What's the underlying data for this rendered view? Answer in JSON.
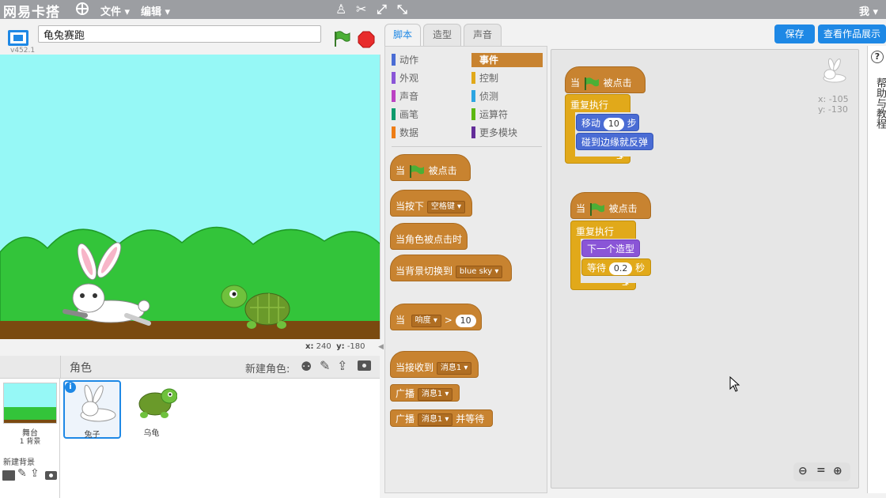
{
  "topbar": {
    "logo": "网易卡搭",
    "menu_file": "文件",
    "menu_edit": "编辑",
    "user": "我"
  },
  "stage": {
    "project_title": "龟兔赛跑",
    "version": "v452.1",
    "mouse_x_label": "x:",
    "mouse_x": "240",
    "mouse_y_label": "y:",
    "mouse_y": "-180"
  },
  "sprites": {
    "header_label": "角色",
    "new_sprite_label": "新建角色:",
    "stage_name": "舞台",
    "stage_backdrops": "1 背景",
    "new_backdrop_label": "新建背景",
    "list": [
      {
        "name": "兔子"
      },
      {
        "name": "乌龟"
      }
    ]
  },
  "tabs": {
    "scripts": "脚本",
    "costumes": "造型",
    "sounds": "声音"
  },
  "buttons": {
    "save": "保存",
    "see_project": "查看作品展示"
  },
  "categories": [
    {
      "label": "动作",
      "color": "#4a6cd4"
    },
    {
      "label": "事件",
      "color": "#c88330"
    },
    {
      "label": "外观",
      "color": "#8a55d7"
    },
    {
      "label": "控制",
      "color": "#e1a91a"
    },
    {
      "label": "声音",
      "color": "#bb42c3"
    },
    {
      "label": "侦测",
      "color": "#2ca5e2"
    },
    {
      "label": "画笔",
      "color": "#0e9a6c"
    },
    {
      "label": "运算符",
      "color": "#5cb712"
    },
    {
      "label": "数据",
      "color": "#ee7d16"
    },
    {
      "label": "更多模块",
      "color": "#632d99"
    }
  ],
  "palette": {
    "when": "当",
    "clicked": "被点击",
    "when_key": "当按下",
    "key_space": "空格键",
    "when_sprite_clicked": "当角色被点击时",
    "when_backdrop": "当背景切换到",
    "backdrop_name": "blue sky",
    "when2": "当",
    "loudness": "响度",
    "gt": ">",
    "loud_value": "10",
    "when_receive": "当接收到",
    "msg1": "消息1",
    "broadcast": "广播",
    "msg2": "消息1",
    "broadcast2": "广播",
    "msg3": "消息1",
    "and_wait": "并等待"
  },
  "script1": {
    "when": "当",
    "clicked": "被点击",
    "forever": "重复执行",
    "move": "移动",
    "steps_value": "10",
    "steps": "步",
    "bounce": "碰到边缘就反弹"
  },
  "script2": {
    "when": "当",
    "clicked": "被点击",
    "forever": "重复执行",
    "next_costume": "下一个造型",
    "wait": "等待",
    "wait_value": "0.2",
    "seconds": "秒"
  },
  "sprite_info": {
    "x": "x: -105",
    "y": "y: -130"
  },
  "help": {
    "label": "帮助与教程"
  }
}
